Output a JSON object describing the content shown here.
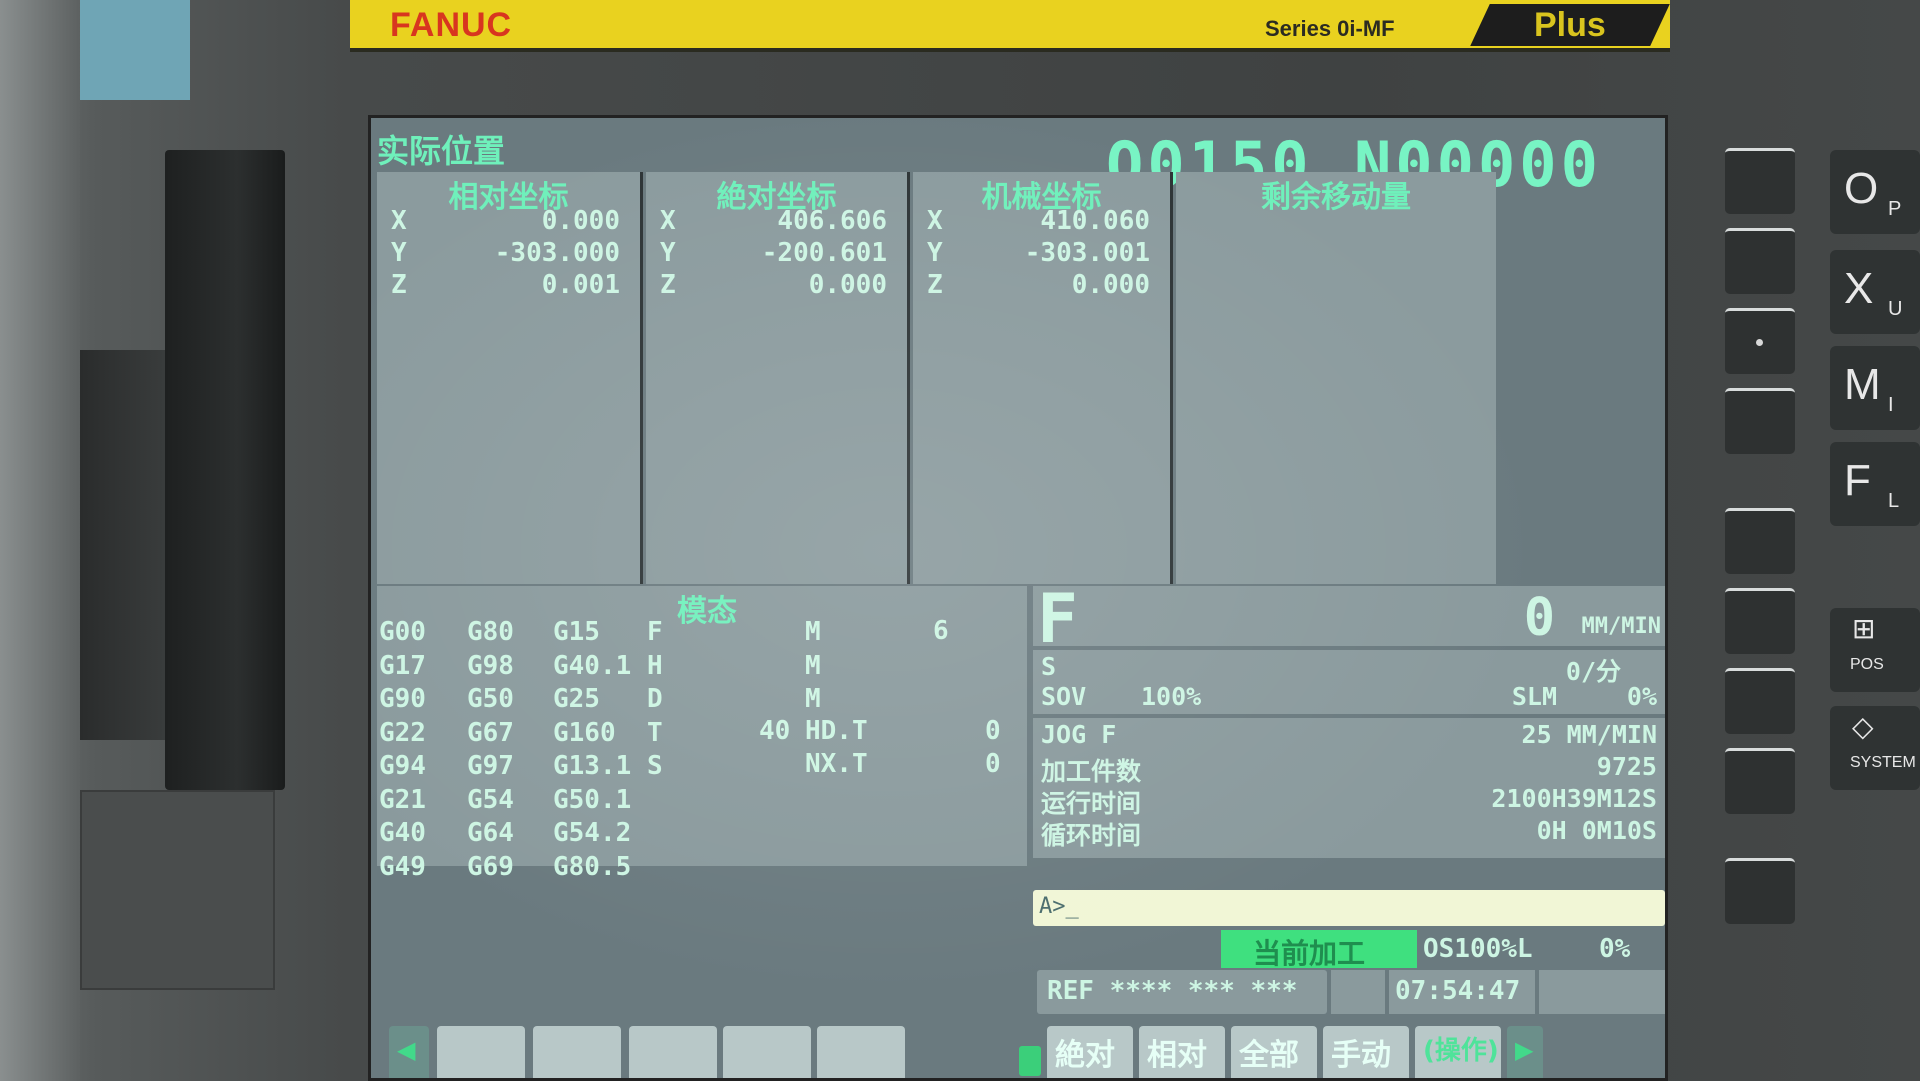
{
  "brand": {
    "logo": "FANUC",
    "series": "Series 0i-MF",
    "plus": "Plus"
  },
  "header": {
    "title": "实际位置",
    "program": "O0150 N00000"
  },
  "position": {
    "relative": {
      "title": "相对坐标",
      "axes": [
        {
          "axis": "X",
          "value": "0.000"
        },
        {
          "axis": "Y",
          "value": "-303.000"
        },
        {
          "axis": "Z",
          "value": "0.001"
        }
      ]
    },
    "absolute": {
      "title": "絶对坐标",
      "axes": [
        {
          "axis": "X",
          "value": "406.606"
        },
        {
          "axis": "Y",
          "value": "-200.601"
        },
        {
          "axis": "Z",
          "value": "0.000"
        }
      ]
    },
    "machine": {
      "title": "机械坐标",
      "axes": [
        {
          "axis": "X",
          "value": "410.060"
        },
        {
          "axis": "Y",
          "value": "-303.001"
        },
        {
          "axis": "Z",
          "value": "0.000"
        }
      ]
    },
    "remaining": {
      "title": "剩余移动量"
    }
  },
  "modal": {
    "title": "模态",
    "col1": [
      "G00",
      "G17",
      "G90",
      "G22",
      "G94",
      "G21",
      "G40",
      "G49"
    ],
    "col2": [
      "G80",
      "G98",
      "G50",
      "G67",
      "G97",
      "G54",
      "G64",
      "G69"
    ],
    "col3": [
      "G15",
      "G40.1",
      "G25",
      "G160",
      "G13.1",
      "G50.1",
      "G54.2",
      "G80.5"
    ],
    "letters": [
      "F",
      "H",
      "D",
      "T",
      "S"
    ],
    "m_label": "M",
    "m_value": "6",
    "hdt_prefix": "40",
    "hdt_label": "HD.T",
    "hdt_value": "0",
    "nxt_label": "NX.T",
    "nxt_value": "0"
  },
  "feed": {
    "label": "F",
    "value": "0",
    "unit": "MM/MIN"
  },
  "spindle": {
    "label": "S",
    "speed": "0/分",
    "sov_label": "SOV",
    "sov_value": "100%",
    "slm_label": "SLM",
    "slm_value": "0%"
  },
  "info": {
    "jog_label": "JOG F",
    "jog_value": "25 MM/MIN",
    "parts_label": "加工件数",
    "parts_value": "9725",
    "run_label": "运行时间",
    "run_value": "2100H39M12S",
    "cycle_label": "循环时间",
    "cycle_value": "0H 0M10S"
  },
  "input": {
    "prompt": "A>_"
  },
  "status": {
    "mode": "当前加工",
    "override": "OS100%L",
    "load": "0%",
    "ref": "REF **** *** ***",
    "time": "07:54:47"
  },
  "softkeys": [
    "絶对",
    "相对",
    "全部",
    "手动",
    "(操作)"
  ],
  "keypad": [
    {
      "main": "O",
      "sub": "P"
    },
    {
      "main": "X",
      "sub": "U"
    },
    {
      "main": "M",
      "sub": "I"
    },
    {
      "main": "F",
      "sub": "L"
    },
    {
      "main": "⊞",
      "sub": "POS"
    },
    {
      "main": "◇",
      "sub": "SYSTEM"
    }
  ],
  "colors": {
    "screen": "#8a9a9d",
    "text": "#cdf5e3",
    "header": "#6ff0bb",
    "mode": "#3fe07f",
    "brand": "#e9d21f"
  }
}
